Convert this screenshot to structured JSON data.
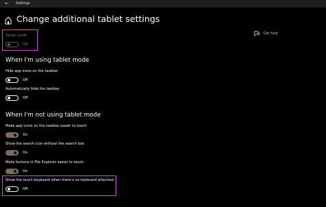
{
  "window": {
    "title": "Settings",
    "back_icon": "back-arrow-icon"
  },
  "page": {
    "title": "Change additional tablet settings",
    "header_icon": "home-icon"
  },
  "help": {
    "label": "Get help",
    "icon": "chat-bubble-icon"
  },
  "tablet_mode": {
    "label": "Tablet mode",
    "state": "Off"
  },
  "section_using": {
    "heading": "When I'm using tablet mode",
    "hide_app_icons": {
      "label": "Hide app icons on the taskbar",
      "state": "Off"
    },
    "auto_hide_taskbar": {
      "label": "Automatically hide the taskbar",
      "state": "Off"
    }
  },
  "section_not_using": {
    "heading": "When I'm not using tablet mode",
    "easier_touch_icons": {
      "label": "Make app icons on the taskbar easier to touch",
      "state": "On"
    },
    "search_icon": {
      "label": "Show the search icon without the search box",
      "state": "On"
    },
    "file_explorer_buttons": {
      "label": "Make buttons in File Explorer easier to touch",
      "state": "On"
    },
    "touch_keyboard": {
      "label": "Show the touch keyboard when there's no keyboard attached",
      "state": "Off"
    }
  },
  "colors": {
    "highlight": "#d04fd7",
    "toggle_on": "#7a6a60"
  }
}
